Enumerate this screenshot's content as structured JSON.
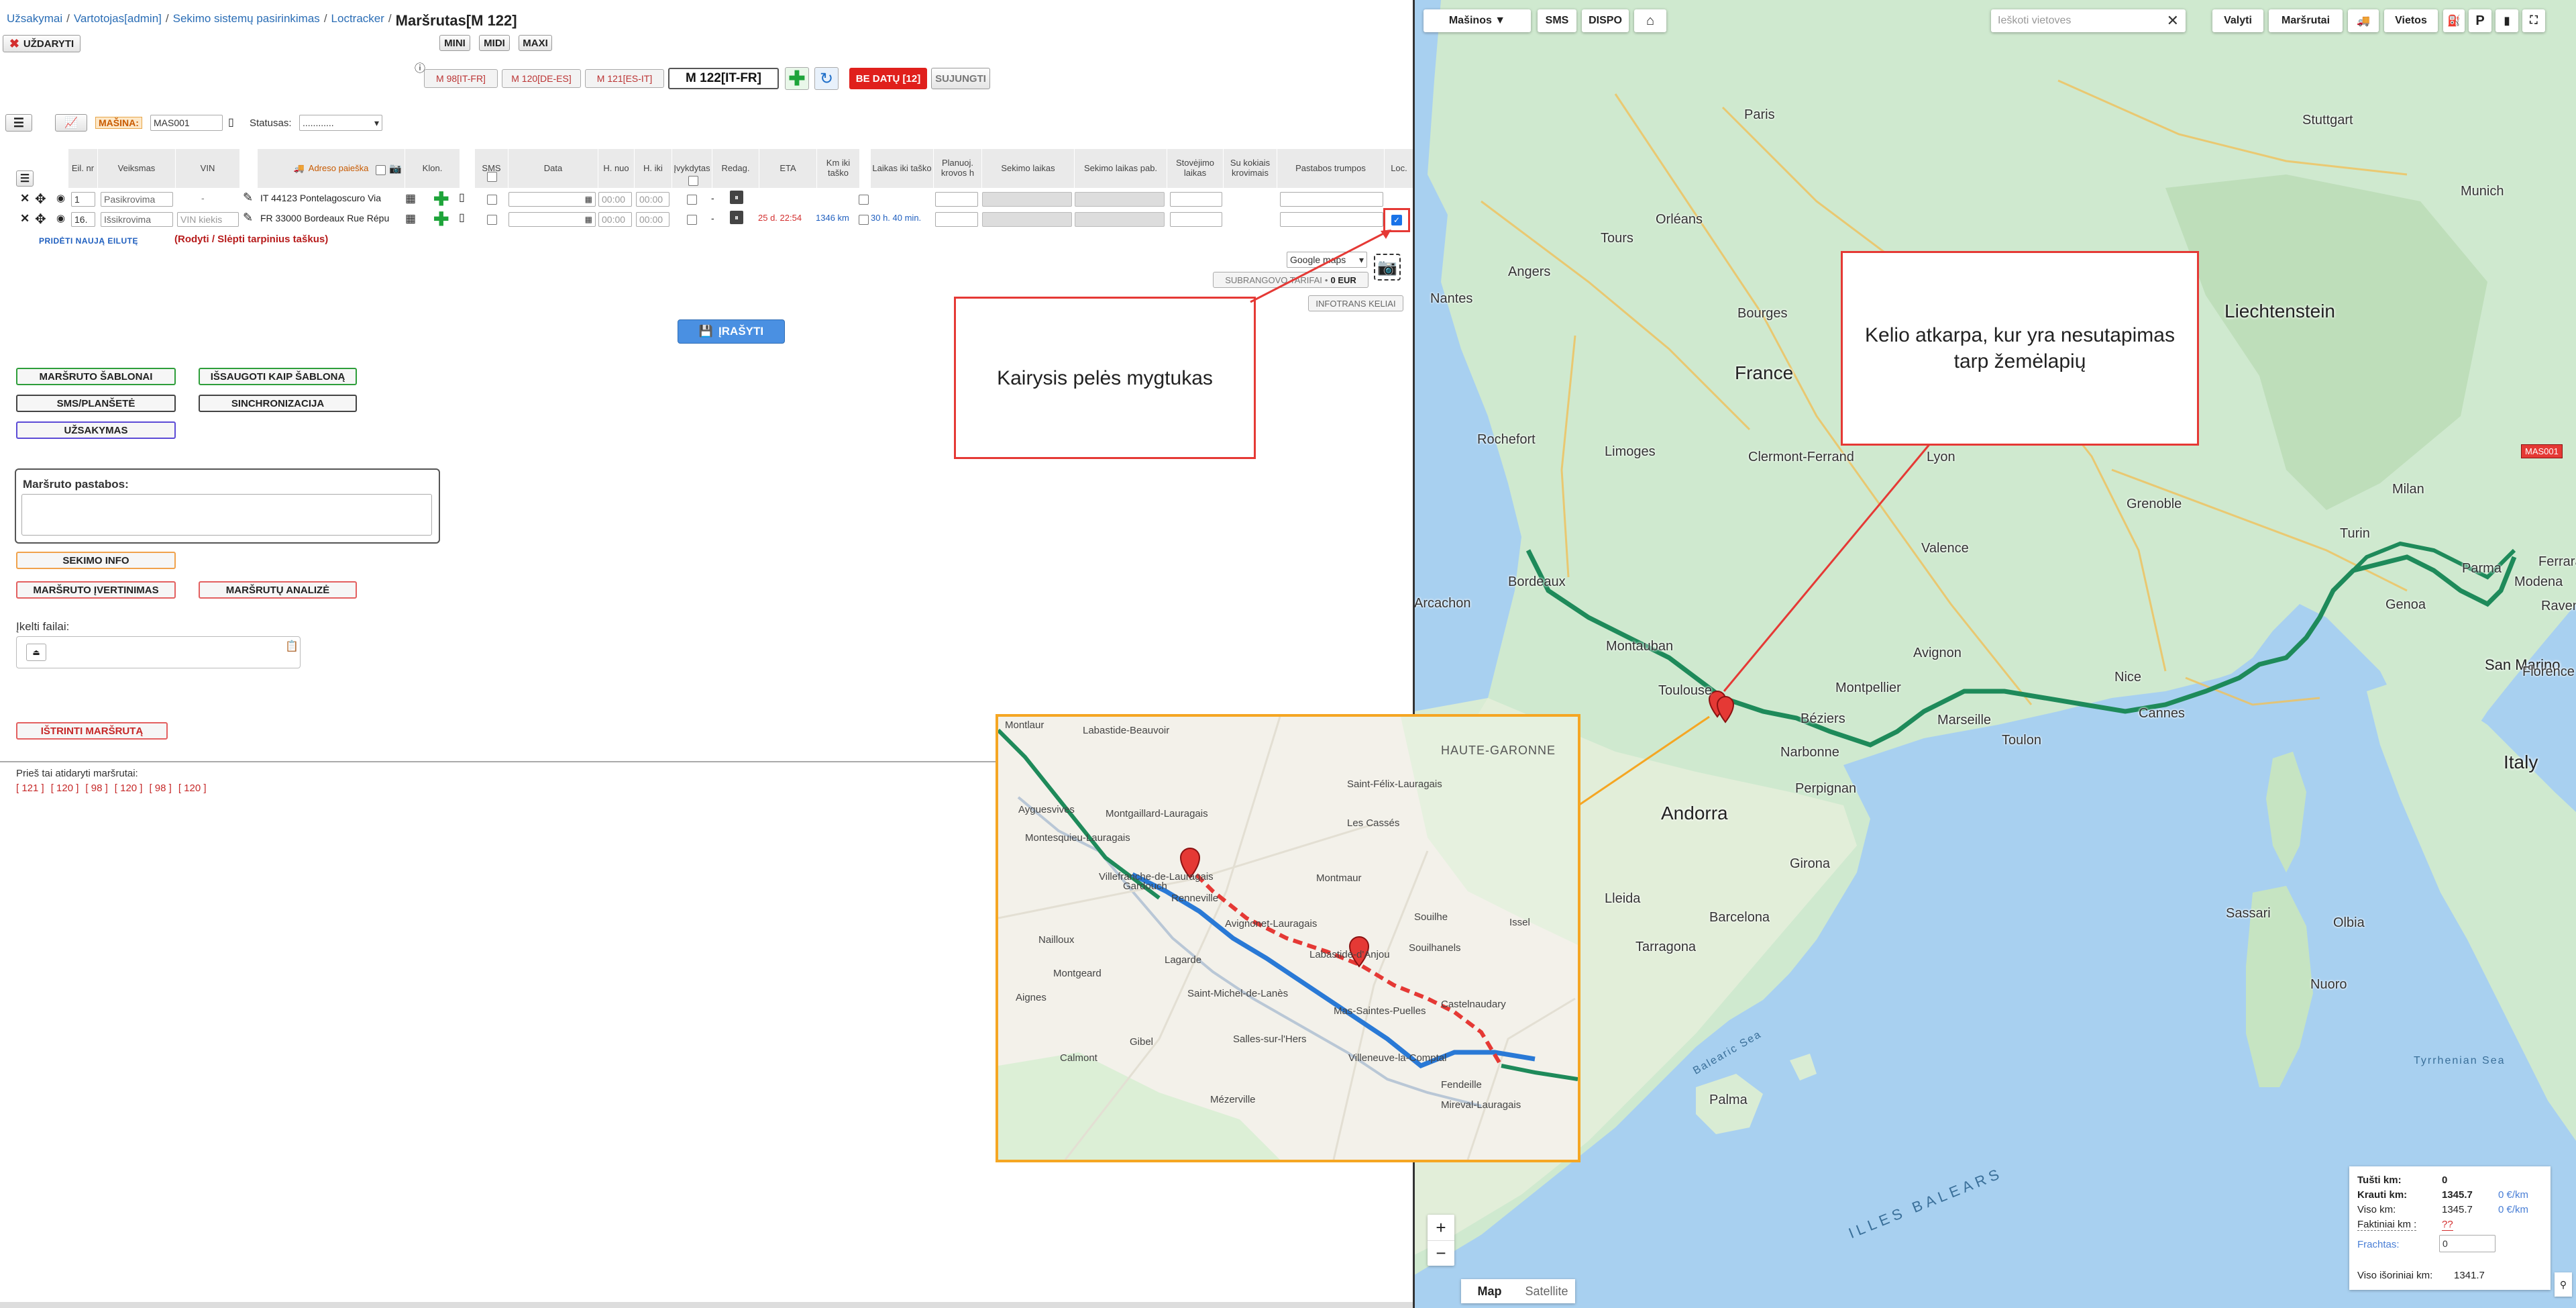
{
  "breadcrumb": {
    "items": [
      "Užsakymai",
      "Vartotojas[admin]",
      "Sekimo sistemų pasirinkimas",
      "Loctracker"
    ],
    "current": "Maršrutas[M 122]"
  },
  "close_button": {
    "label": "UŽDARYTI"
  },
  "view_buttons": [
    "MINI",
    "MIDI",
    "MAXI"
  ],
  "route_tabs": [
    {
      "label": "M 98[IT-FR]"
    },
    {
      "label": "M 120[DE-ES]"
    },
    {
      "label": "M 121[ES-IT]"
    },
    {
      "label": "M 122[IT-FR]",
      "active": true
    }
  ],
  "no_dates_button": "BE DATŲ [12]",
  "merge_button": "SUJUNGTI",
  "vehicle": {
    "label": "MAŠINA:",
    "value": "MAS001",
    "status_label": "Statusas:",
    "status_value": "............"
  },
  "table": {
    "headers": [
      "Eil. nr",
      "Veiksmas",
      "VIN",
      "Adreso paieška",
      "Klon.",
      "SMS",
      "Data",
      "H. nuo",
      "H. iki",
      "Įvykdytas",
      "Redag.",
      "ETA",
      "Km iki taško",
      "Laikas iki taško",
      "Planuoj. krovos h",
      "Sekimo laikas",
      "Sekimo laikas pab.",
      "Stovėjimo laikas",
      "Su kokiais krovimais",
      "Pastabos trumpos",
      "Loc."
    ],
    "rows": [
      {
        "nr": "1",
        "action": "Pasikrovima",
        "vin": "-",
        "address": "IT 44123 Pontelagoscuro Via",
        "h_from": "00:00",
        "h_to": "00:00",
        "eta": "",
        "km": "",
        "time": ""
      },
      {
        "nr": "16.",
        "action": "Išsikrovima",
        "vin_placeholder": "VIN kiekis",
        "address": "FR 33000 Bordeaux Rue Répu",
        "h_from": "00:00",
        "h_to": "00:00",
        "eta": "25 d. 22:54",
        "km": "1346 km",
        "time": "30 h. 40 min."
      }
    ],
    "add_row_link": "PRIDĖTI NAUJĄ EILUTĘ",
    "toggle_points_link": "(Rodyti / Slėpti tarpinius taškus)"
  },
  "map_controls_left": {
    "maps_select": "Google maps",
    "subcontractor": "SUBRANGOVO TARIFAI",
    "subcontractor_sum": "0 EUR",
    "infotrans": "INFOTRANS KELIAI"
  },
  "save_button": "ĮRAŠYTI",
  "action_buttons": {
    "templates": "MARŠRUTO ŠABLONAI",
    "save_template": "IŠSAUGOTI KAIP ŠABLONĄ",
    "sms": "SMS/PLANŠETĖ",
    "sync": "SINCHRONIZACIJA",
    "order": "UŽSAKYMAS",
    "tracking_info": "SEKIMO INFO",
    "route_eval": "MARŠRUTO ĮVERTINIMAS",
    "route_analysis": "MARŠRUTŲ ANALIZĖ",
    "delete": "IŠTRINTI MARŠRUTĄ"
  },
  "notes": {
    "label": "Maršruto pastabos:"
  },
  "files": {
    "label": "Įkelti failai:"
  },
  "previous": {
    "label": "Prieš tai atidaryti maršrutai:",
    "items": [
      "[ 121 ]",
      "[ 120 ]",
      "[ 98 ]",
      "[ 120 ]",
      "[ 98 ]",
      "[ 120 ]"
    ]
  },
  "callouts": {
    "left_click": "Kairysis pelės mygtukas",
    "mismatch": "Kelio atkarpa, kur yra nesutapimas tarp žemėlapių"
  },
  "map": {
    "toolbar": [
      "Mašinos ▼",
      "SMS",
      "DISPO"
    ],
    "search_placeholder": "Ieškoti vietoves",
    "toolbar_right": [
      "Valyti",
      "Maršrutai",
      "Vietos"
    ],
    "vehicle_marker": "MAS001",
    "map_tabs": [
      "Map",
      "Satellite"
    ],
    "countries": [
      "France",
      "Liechtenstein",
      "Italy",
      "Andorra",
      "San Marino"
    ],
    "cities": [
      "Paris",
      "Stuttgart",
      "Munich",
      "Orléans",
      "Tours",
      "Nantes",
      "Angers",
      "Bourges",
      "Limoges",
      "Clermont-Ferrand",
      "Lyon",
      "Rochefort",
      "Bordeaux",
      "Arcachon",
      "Montauban",
      "Toulouse",
      "Montpellier",
      "Avignon",
      "Marseille",
      "Toulon",
      "Nice",
      "Cannes",
      "Béziers",
      "Narbonne",
      "Perpignan",
      "Girona",
      "Barcelona",
      "Tarragona",
      "Lleida",
      "Milan",
      "Turin",
      "Genoa",
      "Parma",
      "Modena",
      "Ferrara",
      "Ravenna",
      "Florence",
      "Valence",
      "Grenoble",
      "Palma",
      "Nuoro",
      "Sassari",
      "Olbia"
    ],
    "seas": [
      "Balearic Sea",
      "Tyrrhenian Sea",
      "ILLES BALEARS"
    ],
    "zoom_in": "+",
    "zoom_out": "−"
  },
  "inset": {
    "region": "HAUTE-GARONNE",
    "towns": [
      "Montlaur",
      "Labastide-Beauvoir",
      "Villefranche-de-Lauragais",
      "Montesquieu-Lauragais",
      "Montgaillard-Lauragais",
      "Saint-Félix-Lauragais",
      "Les Cassés",
      "Montmaur",
      "Renneville",
      "Avignonet-Lauragais",
      "Labastide-d'Anjou",
      "Souilhe",
      "Souilhanels",
      "Nailloux",
      "Montgeard",
      "Lagarde",
      "Saint-Michel-de-Lanès",
      "Castelnaudary",
      "Mas-Saintes-Puelles",
      "Villeneuve-la-Comptal",
      "Salles-sur-l'Hers",
      "Gibel",
      "Calmont",
      "Mézerville",
      "Fendeille",
      "Aignes",
      "Gardouch",
      "Ayguesvives",
      "Issel",
      "Mireval-Lauragais"
    ]
  },
  "summary": {
    "rows": [
      {
        "label": "Tušti km:",
        "value": "0",
        "rate": ""
      },
      {
        "label": "Krauti km:",
        "value": "1345.7",
        "rate": "0 €/km"
      },
      {
        "label": "Viso km:",
        "value": "1345.7",
        "rate": "0 €/km"
      },
      {
        "label": "Faktiniai km :",
        "value": "??",
        "rate": ""
      }
    ],
    "freight_label": "Frachtas:",
    "freight_value": "0",
    "external_label": "Viso išoriniai km:",
    "external_value": "1341.7"
  },
  "colors": {
    "route_green": "#1e8a5a",
    "route_blue": "#2979d6",
    "route_red": "#e53935",
    "callout_red": "#e53935",
    "inset_border": "#f5a623"
  }
}
